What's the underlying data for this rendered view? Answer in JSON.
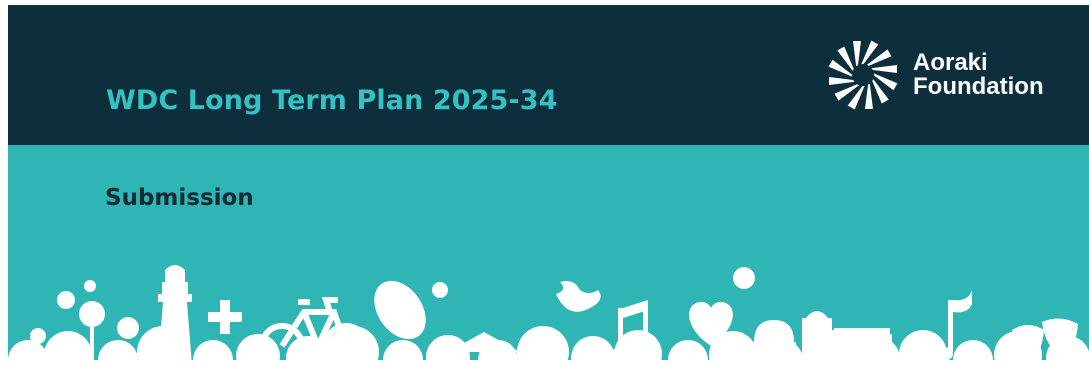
{
  "header": {
    "title": "WDC Long Term Plan 2025-34",
    "brand": {
      "line1": "Aoraki",
      "line2": "Foundation",
      "logo_icon": "sunburst-icon"
    }
  },
  "content": {
    "subtitle": "Submission"
  },
  "colors": {
    "dark_band": "#0d2f3c",
    "teal_band": "#2fb5b4",
    "title_color": "#33c1c3",
    "subtitle_color": "#142a36",
    "skyline_color": "#ffffff"
  },
  "illustration": {
    "icons": [
      "flower-icon",
      "lighthouse-icon",
      "plus-icon",
      "bicycle-icon",
      "rugby-ball-icon",
      "gazebo-icon",
      "bird-icon",
      "music-note-icon",
      "heart-icon",
      "observatory-icon",
      "building-icon",
      "theatre-masks-icon",
      "cloud-icon"
    ]
  }
}
